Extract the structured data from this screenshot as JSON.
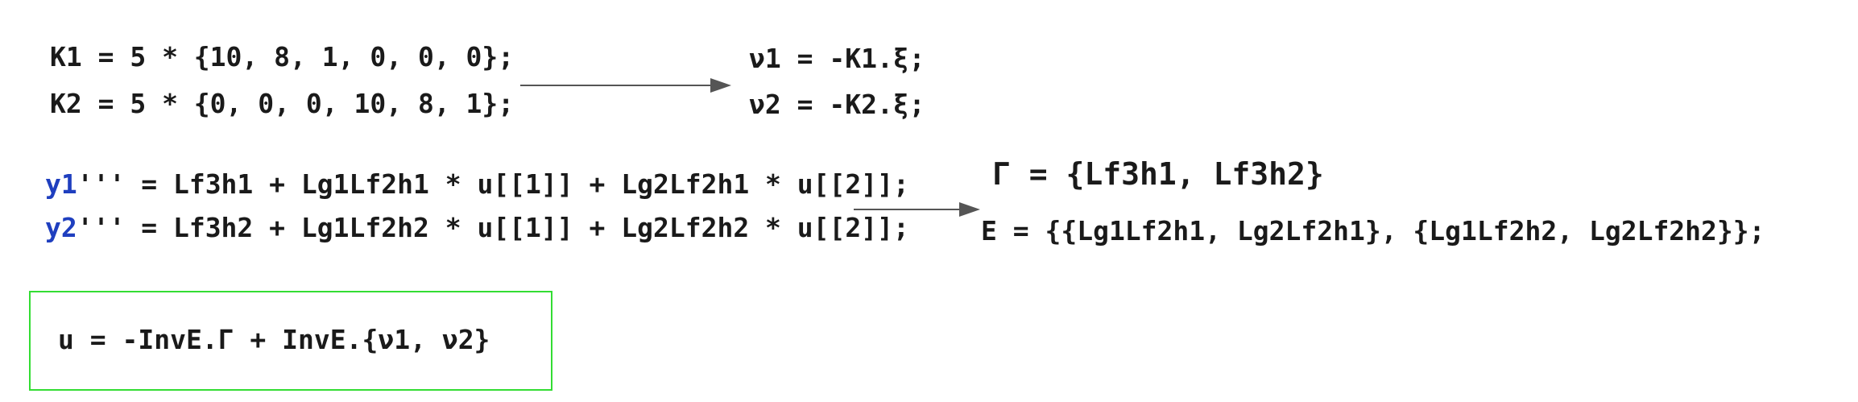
{
  "gains": {
    "k1": "K1 = 5 * {10, 8, 1, 0, 0, 0};",
    "k2": "K2 = 5 * {0, 0, 0, 10, 8, 1};"
  },
  "virtual_inputs": {
    "v1": "ν1 = -K1.ξ;",
    "v2": "ν2 = -K2.ξ;"
  },
  "output_derivatives": {
    "y1_label": "y1",
    "y1_rest": "''' = Lf3h1 + Lg1Lf2h1 * u[[1]] + Lg2Lf2h1 * u[[2]];",
    "y2_label": "y2",
    "y2_rest": "''' = Lf3h2 + Lg1Lf2h2 * u[[1]] + Lg2Lf2h2 * u[[2]];"
  },
  "decoupling": {
    "gamma": "Γ = {Lf3h1, Lf3h2}",
    "e_matrix": "E = {{Lg1Lf2h1, Lg2Lf2h1}, {Lg1Lf2h2, Lg2Lf2h2}};"
  },
  "control_law": {
    "u": "u = -InvE.Γ + InvE.{ν1, ν2}"
  },
  "colors": {
    "variable_blue": "#1f3fbf",
    "box_green": "#33dd33",
    "arrow_gray": "#555555",
    "text": "#1a1a1a"
  }
}
